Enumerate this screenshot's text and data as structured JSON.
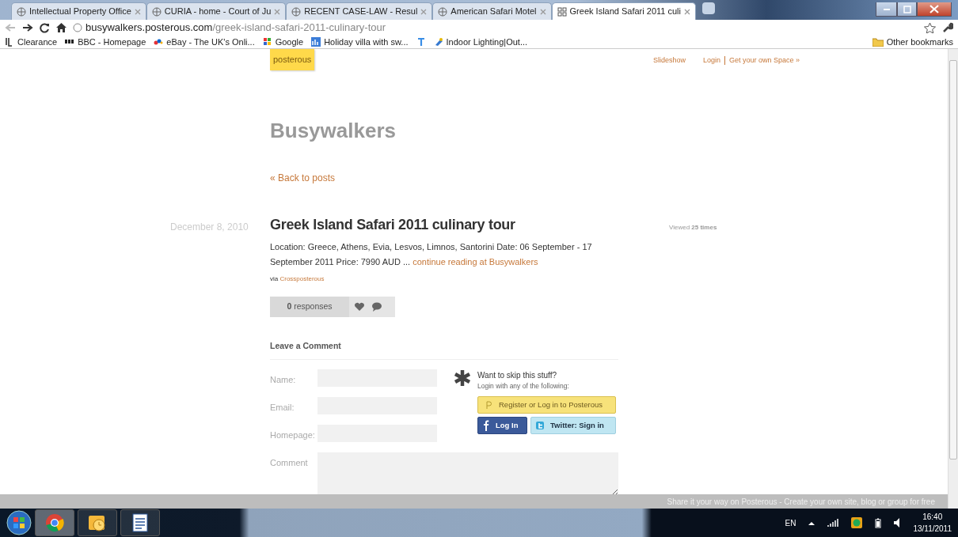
{
  "browser": {
    "tabs": [
      {
        "title": "Intellectual Property Office",
        "selected": false
      },
      {
        "title": "CURIA - home - Court of Ju",
        "selected": false
      },
      {
        "title": "RECENT CASE-LAW - Resul",
        "selected": false
      },
      {
        "title": "American Safari Motel",
        "selected": false
      },
      {
        "title": "Greek Island Safari 2011 culi",
        "selected": true
      }
    ],
    "address": {
      "host": "busywalkers.posterous.com",
      "path": "/greek-island-safari-2011-culinary-tour"
    },
    "bookmarks": [
      {
        "label": "Clearance",
        "kind": "jl"
      },
      {
        "label": "BBC - Homepage",
        "kind": "bbc"
      },
      {
        "label": "eBay - The UK's Onli...",
        "kind": "ebay"
      },
      {
        "label": "Google",
        "kind": "google"
      },
      {
        "label": "Holiday villa with sw...",
        "kind": "chart"
      },
      {
        "kind": "t"
      },
      {
        "label": "Indoor Lighting|Out...",
        "kind": "lamp"
      }
    ],
    "other_bookmarks": "Other bookmarks"
  },
  "page": {
    "logo": "posterous",
    "nav": [
      "Slideshow",
      "Login",
      "Get your own Space »"
    ],
    "blog_title": "Busywalkers",
    "back_link": "« Back to posts",
    "post": {
      "date": "December 8, 2010",
      "title": "Greek Island Safari 2011 culinary tour",
      "body": "Location: Greece, Athens, Evia, Lesvos, Limnos, Santorini Date: 06 September - 17 September 2011 Price: 7990 AUD ...",
      "body_link": "continue reading at Busywalkers",
      "via": "via",
      "via_link": "Crossposterous",
      "responses": "**0** responses",
      "viewed": "Viewed **25 times**"
    },
    "comment_form": {
      "heading": "Leave a Comment",
      "fields": [
        {
          "label": "Name:",
          "kind": "input"
        },
        {
          "label": "Email:",
          "kind": "input"
        },
        {
          "label": "Homepage:",
          "kind": "input"
        },
        {
          "label": "Comment",
          "kind": "textarea"
        }
      ],
      "skip_title": "Want to skip this stuff?",
      "skip_subtitle": "Login with any of the following:",
      "buttons": [
        {
          "label": "Register or Log in to Posterous",
          "kind": "posterous"
        },
        {
          "label": "Log In",
          "kind": "facebook"
        },
        {
          "label": "Twitter: Sign in",
          "kind": "twitter"
        }
      ]
    },
    "share_bar": "Share it your way on Posterous - Create your own site, blog or group for free"
  },
  "taskbar": {
    "apps": [
      {
        "kind": "chrome",
        "active": true
      },
      {
        "kind": "mail",
        "active": false
      },
      {
        "kind": "word",
        "active": false
      }
    ],
    "tray": {
      "lang": "EN",
      "time": "16:40",
      "date": "13/11/2011"
    }
  }
}
